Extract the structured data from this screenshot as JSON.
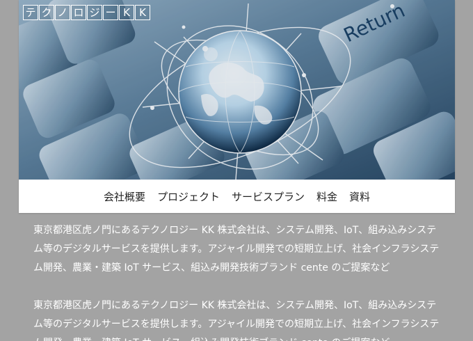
{
  "logo": {
    "text": "テクノロジーKK",
    "chars": [
      "テ",
      "ク",
      "ノ",
      "ロ",
      "ジ",
      "ー",
      "K",
      "K"
    ]
  },
  "hero": {
    "alt": "Globe over keyboard",
    "keyboard_key_label": "Return"
  },
  "nav": {
    "items": [
      {
        "label": "会社概要"
      },
      {
        "label": "プロジェクト"
      },
      {
        "label": "サービスプラン"
      },
      {
        "label": "料金"
      },
      {
        "label": "資料"
      }
    ]
  },
  "content": {
    "paragraphs": [
      {
        "text": "東京都港区虎ノ門にあるテクノロジー KK 株式会社は、システム開発、IoT、組み込みシステム等のデジタルサービスを提供します。アジャイル開発での短期立上げ、社会インフラシステム開発、農業・建築 IoT サービス、組込み開発技術ブランド cente のご提案など"
      },
      {
        "text": "東京都港区虎ノ門にあるテクノロジー KK 株式会社は、システム開発、IoT、組み込みシステム等のデジタルサービスを提供します。アジャイル開発での短期立上げ、社会インフラシステム開発、農業・建築 IoT サービス、組込み開発技術ブランド cente のご提案など"
      }
    ]
  },
  "colors": {
    "background": "#a3a3a3",
    "card": "#ffffff",
    "hero_blue": "#5d7e99",
    "text_white": "#ffffff",
    "nav_text": "#222222"
  }
}
